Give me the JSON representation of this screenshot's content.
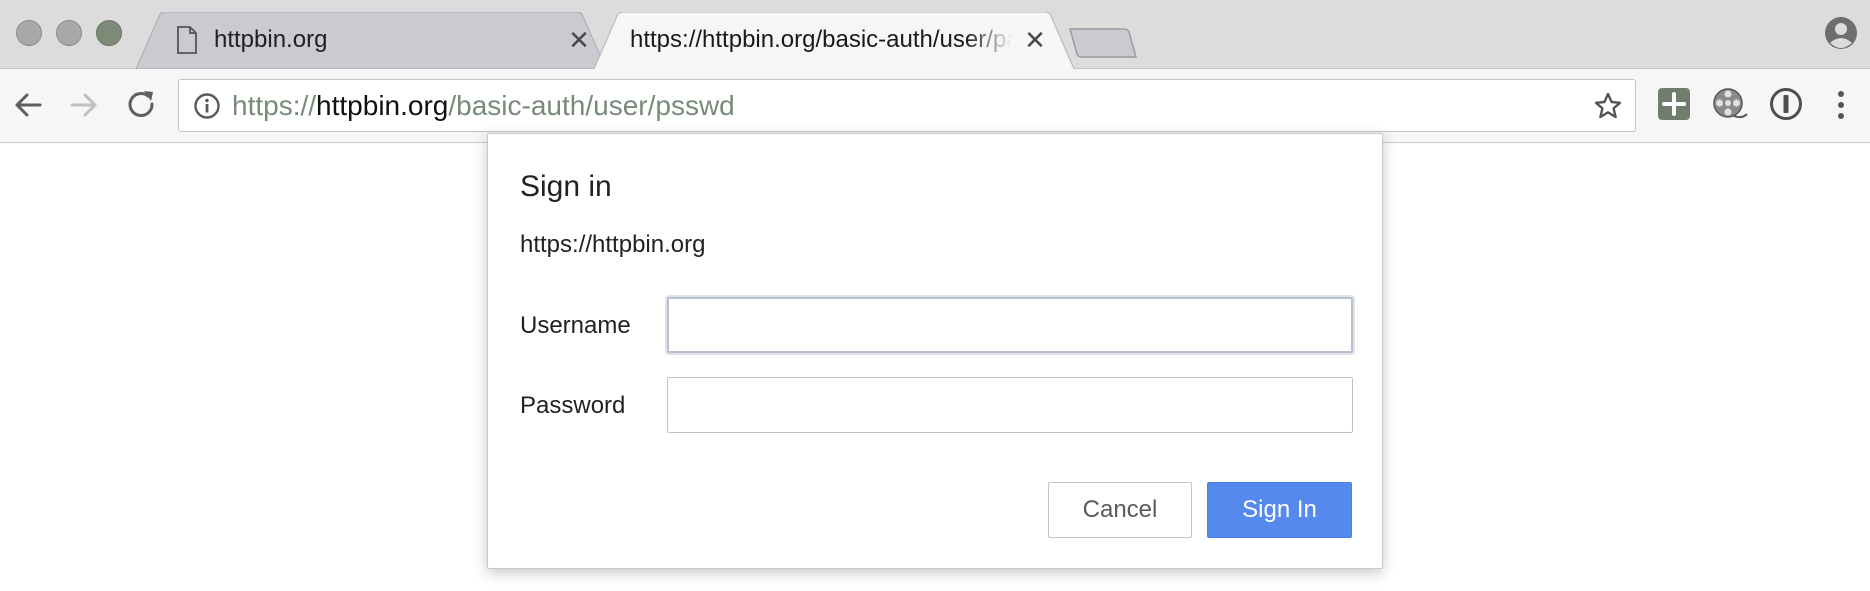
{
  "window": {
    "tabs": [
      {
        "title": "httpbin.org",
        "icon": "page-icon",
        "active": false
      },
      {
        "title": "https://httpbin.org/basic-auth/user/passwd",
        "icon": "",
        "active": true
      }
    ],
    "close_glyph": "✕"
  },
  "toolbar": {
    "url_scheme": "https://",
    "url_host": "httpbin.org",
    "url_path": "/basic-auth/user/psswd",
    "icons": [
      "back-arrow-icon",
      "forward-arrow-icon",
      "reload-icon",
      "info-icon",
      "star-icon",
      "plus-extension-icon",
      "film-reel-extension-icon",
      "password-manager-icon",
      "menu-dots-icon"
    ]
  },
  "dialog": {
    "title": "Sign in",
    "origin": "https://httpbin.org",
    "username_label": "Username",
    "username_value": "",
    "password_label": "Password",
    "password_value": "",
    "cancel_label": "Cancel",
    "signin_label": "Sign In"
  },
  "colors": {
    "accent": "#5589ee",
    "url_dim": "#7a8a7a",
    "tabstrip": "#dcdcdc"
  }
}
